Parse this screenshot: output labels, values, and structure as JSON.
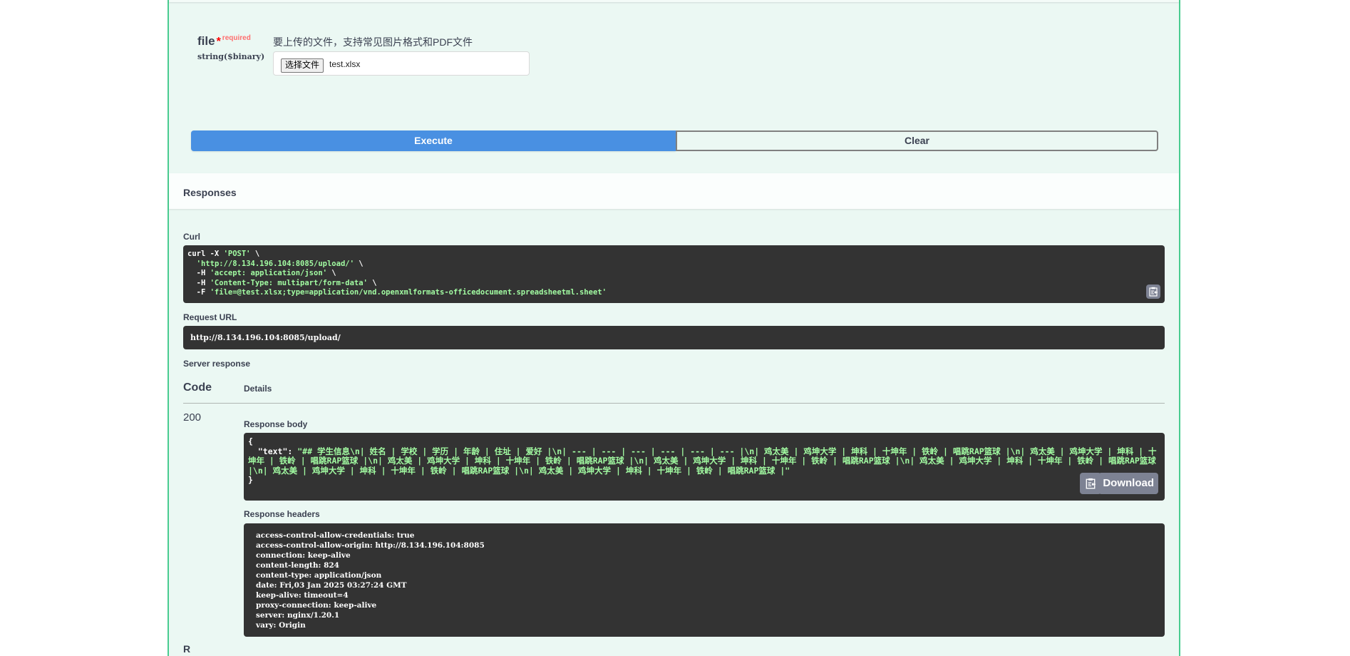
{
  "parameter": {
    "name": "file",
    "required_star": "*",
    "required_label": "required",
    "type": "string($binary)",
    "description": "要上传的文件，支持常见图片格式和PDF文件",
    "file_button_label": "选择文件",
    "file_name": "test.xlsx"
  },
  "actions": {
    "execute_label": "Execute",
    "clear_label": "Clear"
  },
  "responses": {
    "title": "Responses",
    "curl_label": "Curl",
    "curl_lines": [
      {
        "plain": "curl -X ",
        "str": "'POST'",
        "tail": " \\"
      },
      {
        "plain": "  ",
        "str": "'http://8.134.196.104:8085/upload/'",
        "tail": " \\"
      },
      {
        "plain": "  -H ",
        "str": "'accept: application/json'",
        "tail": " \\"
      },
      {
        "plain": "  -H ",
        "str": "'Content-Type: multipart/form-data'",
        "tail": " \\"
      },
      {
        "plain": "  -F ",
        "str": "'file=@test.xlsx;type=application/vnd.openxmlformats-officedocument.spreadsheetml.sheet'",
        "tail": ""
      }
    ],
    "request_url_label": "Request URL",
    "request_url": "http://8.134.196.104:8085/upload/",
    "server_response_label": "Server response",
    "code_header": "Code",
    "details_header": "Details",
    "status_code": "200",
    "response_body_label": "Response body",
    "response_body_open": "{",
    "response_body_key": "  \"text\": ",
    "response_body_value": "\"## 学生信息\\n| 姓名 | 学校 | 学历 | 年龄 | 住址 | 爱好 |\\n| --- | --- | --- | --- | --- | --- |\\n| 鸡太美 | 鸡坤大学 | 坤科 | 十坤年 | 铁岭 | 唱跳RAP篮球 |\\n| 鸡太美 | 鸡坤大学 | 坤科 | 十坤年 | 铁岭 | 唱跳RAP篮球 |\\n| 鸡太美 | 鸡坤大学 | 坤科 | 十坤年 | 铁岭 | 唱跳RAP篮球 |\\n| 鸡太美 | 鸡坤大学 | 坤科 | 十坤年 | 铁岭 | 唱跳RAP篮球 |\\n| 鸡太美 | 鸡坤大学 | 坤科 | 十坤年 | 铁岭 | 唱跳RAP篮球 |\\n| 鸡太美 | 鸡坤大学 | 坤科 | 十坤年 | 铁岭 | 唱跳RAP篮球 |\\n| 鸡太美 | 鸡坤大学 | 坤科 | 十坤年 | 铁岭 | 唱跳RAP篮球 |\"",
    "response_body_close": "}",
    "download_label": "Download",
    "response_headers_label": "Response headers",
    "response_headers": [
      "access-control-allow-credentials: true",
      "access-control-allow-origin: http://8.134.196.104:8085",
      "connection: keep-alive",
      "content-length: 824",
      "content-type: application/json",
      "date: Fri,03 Jan 2025 03:27:24 GMT",
      "keep-alive: timeout=4",
      "proxy-connection: keep-alive",
      "server: nginx/1.20.1",
      "vary: Origin"
    ],
    "next_section_partial": "R"
  },
  "colors": {
    "panel_border": "#49cc90",
    "panel_bg": "#ebf8f3",
    "execute_bg": "#4990e2",
    "code_bg": "#333333",
    "code_string": "#a2fca2"
  }
}
